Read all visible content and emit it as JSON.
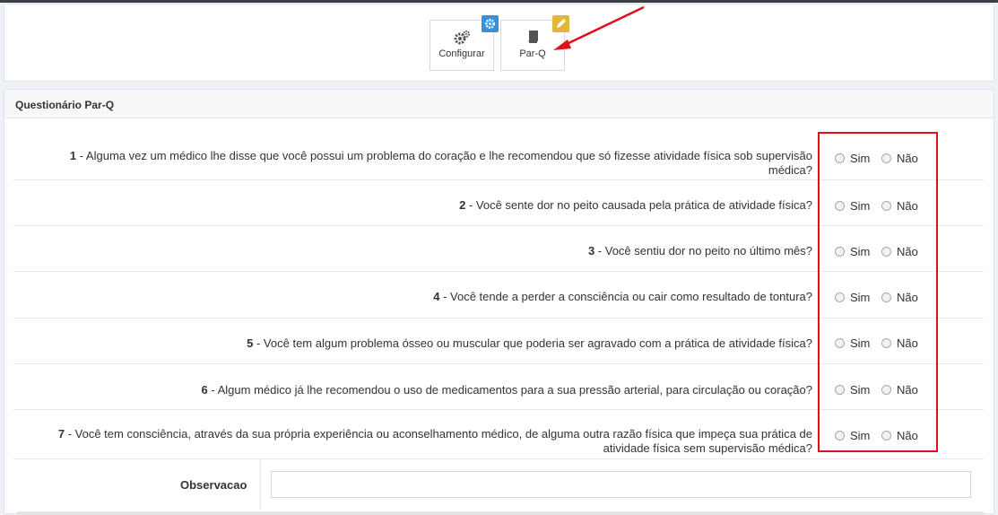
{
  "toolbar": {
    "buttons": [
      {
        "label": "Configurar",
        "icon": "gears-icon",
        "badge_icon": "gear-icon",
        "badge_color": "#3a8fd9"
      },
      {
        "label": "Par-Q",
        "icon": "book-icon",
        "badge_icon": "pencil-icon",
        "badge_color": "#e1b63b"
      }
    ]
  },
  "form": {
    "title": "Questionário Par-Q",
    "option_yes": "Sim",
    "option_no": "Não",
    "questions": [
      {
        "num": "1",
        "text": " - Alguma vez um médico lhe disse que você possui um problema do coração e lhe recomendou que só fizesse atividade física sob supervisão médica?"
      },
      {
        "num": "2",
        "text": " - Você sente dor no peito causada pela prática de atividade física?"
      },
      {
        "num": "3",
        "text": " - Você sentiu dor no peito no último mês?"
      },
      {
        "num": "4",
        "text": " - Você tende a perder a consciência ou cair como resultado de tontura?"
      },
      {
        "num": "5",
        "text": " - Você tem algum problema ósseo ou muscular que poderia ser agravado com a prática de atividade física?"
      },
      {
        "num": "6",
        "text": " - Algum médico já lhe recomendou o uso de medicamentos para a sua pressão arterial, para circulação ou coração?"
      },
      {
        "num": "7",
        "text": " - Você tem consciência, através da sua própria experiência ou aconselhamento médico, de alguma outra razão física que impeça sua prática de atividade física sem supervisão médica?"
      }
    ],
    "observacao_label": "Observacao",
    "observacao_value": ""
  },
  "annotation": {
    "color": "#e0101a"
  }
}
